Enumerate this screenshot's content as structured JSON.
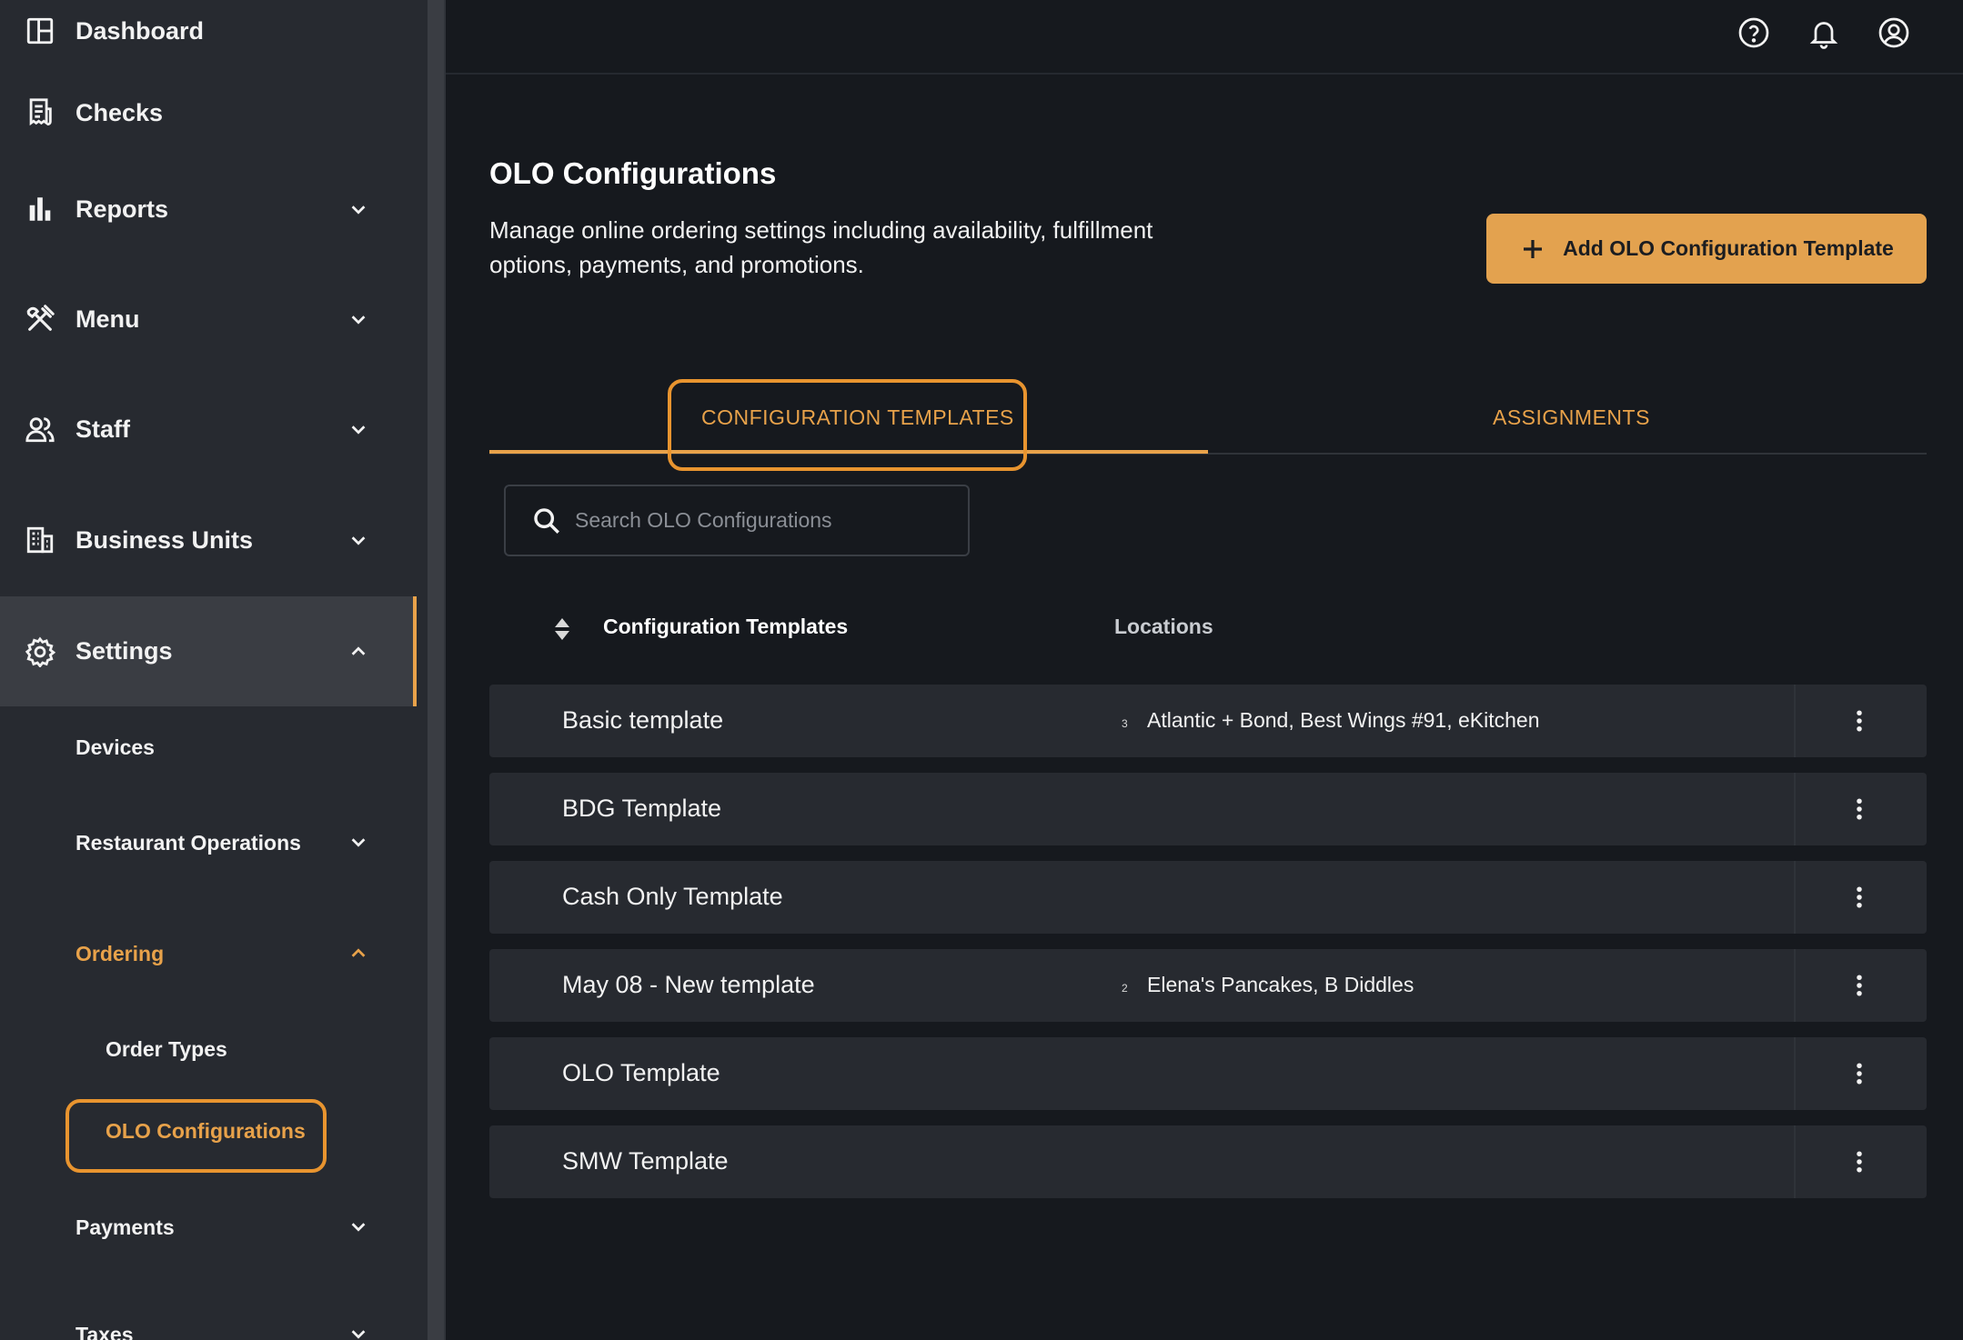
{
  "theme": {
    "accent": "#e8a24a",
    "background": "#16191e",
    "sidebar": "#272a30",
    "row": "#272a30"
  },
  "sidebar": {
    "items": [
      {
        "label": "Dashboard",
        "icon": "dashboard-icon"
      },
      {
        "label": "Checks",
        "icon": "receipt-icon"
      },
      {
        "label": "Reports",
        "icon": "bar-chart-icon",
        "expandable": true
      },
      {
        "label": "Menu",
        "icon": "utensils-icon",
        "expandable": true
      },
      {
        "label": "Staff",
        "icon": "people-icon",
        "expandable": true
      },
      {
        "label": "Business Units",
        "icon": "building-icon",
        "expandable": true
      },
      {
        "label": "Settings",
        "icon": "gear-icon",
        "expandable": true,
        "expanded": true,
        "active": true
      }
    ],
    "settings_children": [
      {
        "label": "Devices"
      },
      {
        "label": "Restaurant Operations",
        "expandable": true
      },
      {
        "label": "Ordering",
        "expandable": true,
        "expanded": true
      },
      {
        "label": "Payments",
        "expandable": true
      },
      {
        "label": "Taxes",
        "expandable": true
      }
    ],
    "ordering_children": [
      {
        "label": "Order Types"
      },
      {
        "label": "OLO Configurations",
        "selected": true
      }
    ]
  },
  "topbar": {
    "icons": [
      "help-icon",
      "bell-icon",
      "account-icon"
    ]
  },
  "main": {
    "title": "OLO Configurations",
    "description": "Manage online ordering settings including availability, fulfillment options, payments, and promotions.",
    "add_button_label": "Add OLO Configuration Template",
    "tabs": [
      {
        "label": "CONFIGURATION TEMPLATES",
        "active": true
      },
      {
        "label": "ASSIGNMENTS",
        "active": false
      }
    ],
    "search": {
      "placeholder": "Search OLO Configurations",
      "value": ""
    },
    "table": {
      "columns": [
        "Configuration Templates",
        "Locations"
      ],
      "rows": [
        {
          "name": "Basic template",
          "count": "3",
          "locations": "Atlantic + Bond, Best Wings #91, eKitchen"
        },
        {
          "name": "BDG Template",
          "count": "",
          "locations": ""
        },
        {
          "name": "Cash Only Template",
          "count": "",
          "locations": ""
        },
        {
          "name": "May 08 - New template",
          "count": "2",
          "locations": "Elena's Pancakes, B Diddles"
        },
        {
          "name": "OLO Template",
          "count": "",
          "locations": ""
        },
        {
          "name": "SMW Template",
          "count": "",
          "locations": ""
        }
      ]
    }
  }
}
